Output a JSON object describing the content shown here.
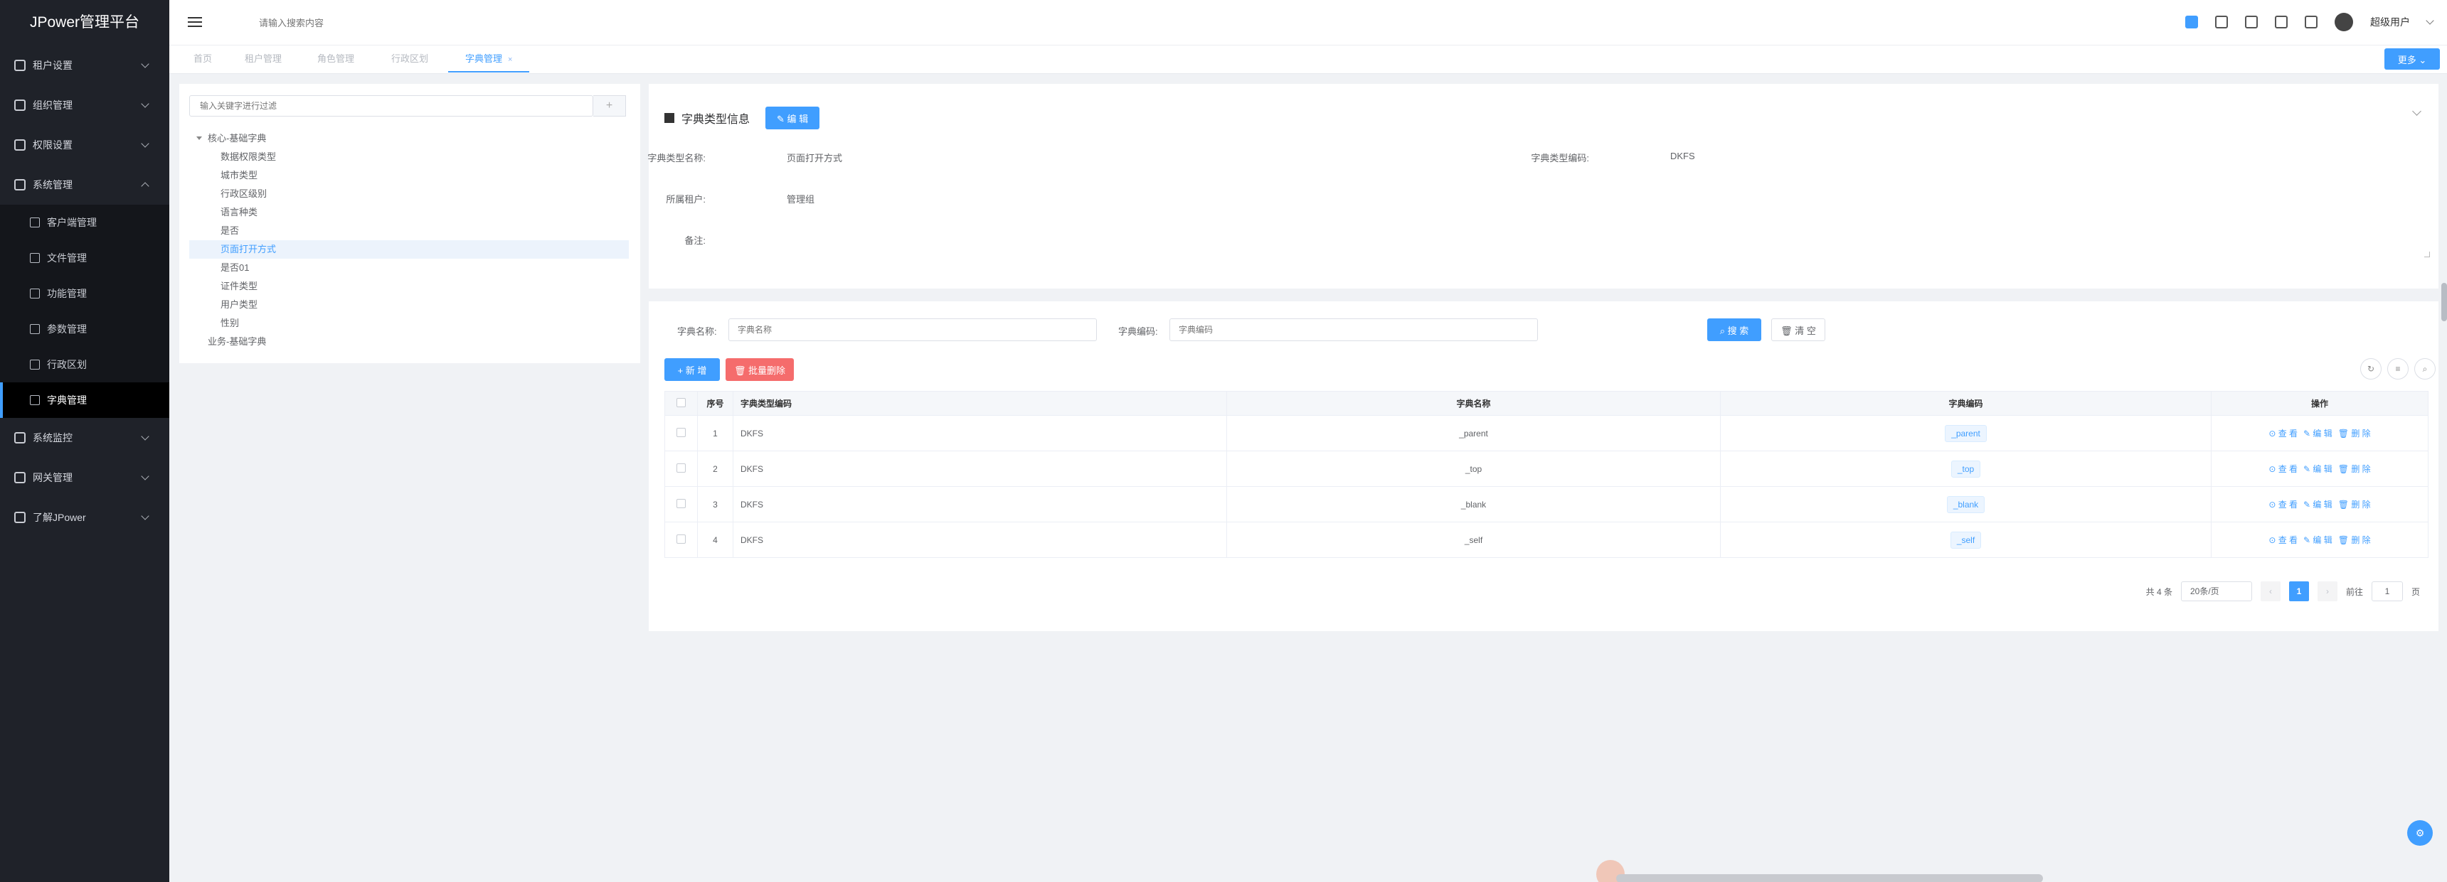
{
  "app": {
    "title": "JPower管理平台"
  },
  "sidebar": {
    "items": [
      {
        "label": "租户设置",
        "icon": "tenant-icon"
      },
      {
        "label": "组织管理",
        "icon": "org-icon"
      },
      {
        "label": "权限设置",
        "icon": "permission-icon"
      },
      {
        "label": "系统管理",
        "icon": "gear-icon"
      },
      {
        "label": "客户端管理",
        "icon": "client-icon"
      },
      {
        "label": "文件管理",
        "icon": "file-icon"
      },
      {
        "label": "功能管理",
        "icon": "function-icon"
      },
      {
        "label": "参数管理",
        "icon": "param-icon"
      },
      {
        "label": "行政区划",
        "icon": "location-icon"
      },
      {
        "label": "字典管理",
        "icon": "dict-icon"
      },
      {
        "label": "系统监控",
        "icon": "monitor-icon"
      },
      {
        "label": "网关管理",
        "icon": "gateway-icon"
      },
      {
        "label": "了解JPower",
        "icon": "flag-icon"
      }
    ]
  },
  "header": {
    "search_placeholder": "请输入搜索内容",
    "user_name": "超级用户"
  },
  "tabs": [
    {
      "label": "首页"
    },
    {
      "label": "租户管理"
    },
    {
      "label": "角色管理"
    },
    {
      "label": "行政区划"
    },
    {
      "label": "字典管理",
      "close": "×"
    }
  ],
  "more_label": "更多 ⌄",
  "tree": {
    "filter_placeholder": "输入关键字进行过滤",
    "add_label": "+",
    "nodes": [
      "核心-基础字典",
      "数据权限类型",
      "城市类型",
      "行政区级别",
      "语言种类",
      "是否",
      "页面打开方式",
      "是否01",
      "证件类型",
      "用户类型",
      "性别",
      "业务-基础字典"
    ]
  },
  "info": {
    "title": "字典类型信息",
    "edit_label": "✎ 编 辑",
    "name_label": "字典类型名称:",
    "name_value": "页面打开方式",
    "code_label": "字典类型编码:",
    "code_value": "DKFS",
    "tenant_label": "所属租户:",
    "tenant_value": "管理组",
    "remark_label": "备注:"
  },
  "query": {
    "name_label": "字典名称:",
    "name_placeholder": "字典名称",
    "code_label": "字典编码:",
    "code_placeholder": "字典编码",
    "search_label": "⌕ 搜 索",
    "reset_label": "🗑 清 空"
  },
  "actions": {
    "add_label": "+ 新 增",
    "batch_delete_label": "🗑 批量删除"
  },
  "table": {
    "headers": [
      "序号",
      "字典类型编码",
      "字典名称",
      "字典编码",
      "操作"
    ],
    "rows": [
      {
        "idx": "1",
        "type": "DKFS",
        "name": "_parent",
        "code": "_parent"
      },
      {
        "idx": "2",
        "type": "DKFS",
        "name": "_top",
        "code": "_top"
      },
      {
        "idx": "3",
        "type": "DKFS",
        "name": "_blank",
        "code": "_blank"
      },
      {
        "idx": "4",
        "type": "DKFS",
        "name": "_self",
        "code": "_self"
      }
    ],
    "ops": {
      "view": "⊙ 查 看",
      "edit": "✎ 编 辑",
      "delete": "🗑 删 除"
    }
  },
  "pager": {
    "total": "共 4 条",
    "page_size": "20条/页",
    "current": "1",
    "goto_label": "前往",
    "goto_value": "1",
    "page_unit": "页"
  },
  "colors": {
    "accent": "#409eff",
    "sidebar_bg": "#1f2229",
    "danger": "#f56c6c"
  }
}
